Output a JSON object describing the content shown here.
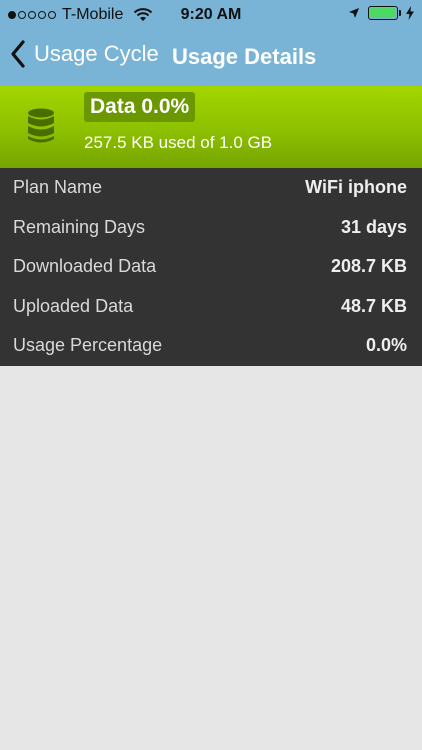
{
  "status_bar": {
    "carrier": "T-Mobile",
    "time": "9:20 AM",
    "signal_bars_full": 1,
    "signal_bars_total": 5,
    "battery_level": 1.0,
    "icons": [
      "signal-icon",
      "wifi-icon",
      "location-icon",
      "battery-icon",
      "charging-bolt-icon"
    ]
  },
  "nav": {
    "back_label": "Usage Cycle",
    "title": "Usage Details"
  },
  "banner": {
    "title": "Data 0.0%",
    "subtitle": "257.5 KB used of 1.0 GB",
    "icon": "database-icon"
  },
  "details": {
    "rows": [
      {
        "label": "Plan Name",
        "value": "WiFi iphone"
      },
      {
        "label": "Remaining Days",
        "value": "31 days"
      },
      {
        "label": "Downloaded Data",
        "value": "208.7 KB"
      },
      {
        "label": "Uploaded Data",
        "value": "48.7 KB"
      },
      {
        "label": "Usage Percentage",
        "value": "0.0%"
      }
    ]
  },
  "colors": {
    "header_blue": "#79b4d6",
    "banner_green": "#8fc200",
    "details_bg": "#333333",
    "page_bg": "#e6e6e6",
    "battery_green": "#4cd964"
  }
}
